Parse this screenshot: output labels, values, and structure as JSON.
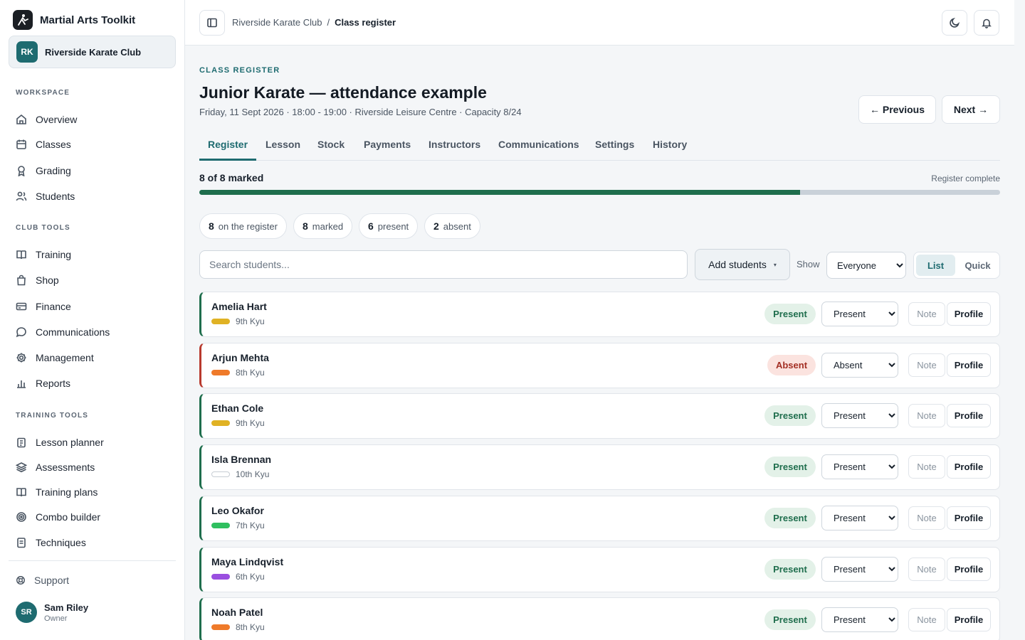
{
  "app": {
    "title": "Martial Arts Toolkit"
  },
  "club": {
    "initials": "RK",
    "name": "Riverside Karate Club"
  },
  "sidebar": {
    "sections": {
      "workspace": "WORKSPACE",
      "club_tools": "CLUB TOOLS",
      "training_tools": "TRAINING TOOLS"
    },
    "workspace": [
      {
        "label": "Overview",
        "icon": "home-icon"
      },
      {
        "label": "Classes",
        "icon": "calendar-icon"
      },
      {
        "label": "Grading",
        "icon": "award-icon"
      },
      {
        "label": "Students",
        "icon": "users-icon"
      }
    ],
    "club_tools": [
      {
        "label": "Training",
        "icon": "book-icon"
      },
      {
        "label": "Shop",
        "icon": "shopping-bag-icon"
      },
      {
        "label": "Finance",
        "icon": "credit-card-icon"
      },
      {
        "label": "Communications",
        "icon": "message-icon"
      },
      {
        "label": "Management",
        "icon": "gear-icon"
      },
      {
        "label": "Reports",
        "icon": "bar-chart-icon"
      }
    ],
    "training_tools": [
      {
        "label": "Lesson planner",
        "icon": "clipboard-icon"
      },
      {
        "label": "Assessments",
        "icon": "layers-icon"
      },
      {
        "label": "Training plans",
        "icon": "book-open-icon"
      },
      {
        "label": "Combo builder",
        "icon": "target-icon"
      },
      {
        "label": "Techniques",
        "icon": "file-text-icon"
      }
    ],
    "support": "Support",
    "user": {
      "initials": "SR",
      "name": "Sam Riley",
      "role": "Owner"
    }
  },
  "header": {
    "breadcrumb_parent": "Riverside Karate Club",
    "breadcrumb_separator": "/",
    "breadcrumb_current": "Class register"
  },
  "page": {
    "eyebrow": "CLASS REGISTER",
    "title": "Junior Karate — attendance example",
    "subtitle": "Friday, 11 Sept 2026 · 18:00 - 19:00 · Riverside Leisure Centre · Capacity 8/24",
    "previous_label": "← Previous",
    "next_label": "Next →"
  },
  "tabs": [
    "Register",
    "Lesson",
    "Stock",
    "Payments",
    "Instructors",
    "Communications",
    "Settings",
    "History"
  ],
  "progress": {
    "label": "8 of 8 marked",
    "status": "Register complete",
    "fraction": 0.75
  },
  "stats": [
    {
      "value": "8",
      "label": "on the register"
    },
    {
      "value": "8",
      "label": "marked"
    },
    {
      "value": "6",
      "label": "present"
    },
    {
      "value": "2",
      "label": "absent"
    }
  ],
  "toolbar": {
    "search_placeholder": "Search students...",
    "add_label": "Add students",
    "add_caret": "▾",
    "show_label": "Show",
    "show_selected": "Everyone",
    "view_list": "List",
    "view_quick": "Quick"
  },
  "row_actions": {
    "note": "Note",
    "profile": "Profile"
  },
  "students": [
    {
      "name": "Amelia Hart",
      "grade": "9th Kyu",
      "belt_color": "#e0b224",
      "status": "Present"
    },
    {
      "name": "Arjun Mehta",
      "grade": "8th Kyu",
      "belt_color": "#ef7a2a",
      "status": "Absent"
    },
    {
      "name": "Ethan Cole",
      "grade": "9th Kyu",
      "belt_color": "#e0b224",
      "status": "Present"
    },
    {
      "name": "Isla Brennan",
      "grade": "10th Kyu",
      "belt_color": "#ffffff",
      "status": "Present"
    },
    {
      "name": "Leo Okafor",
      "grade": "7th Kyu",
      "belt_color": "#2fbf5f",
      "status": "Present"
    },
    {
      "name": "Maya Lindqvist",
      "grade": "6th Kyu",
      "belt_color": "#9a4fe0",
      "status": "Present"
    },
    {
      "name": "Noah Patel",
      "grade": "8th Kyu",
      "belt_color": "#ef7a2a",
      "status": "Present"
    }
  ],
  "colors": {
    "accent": "#1e6b70",
    "present": "#1f6e4d",
    "absent": "#b83a2e"
  }
}
